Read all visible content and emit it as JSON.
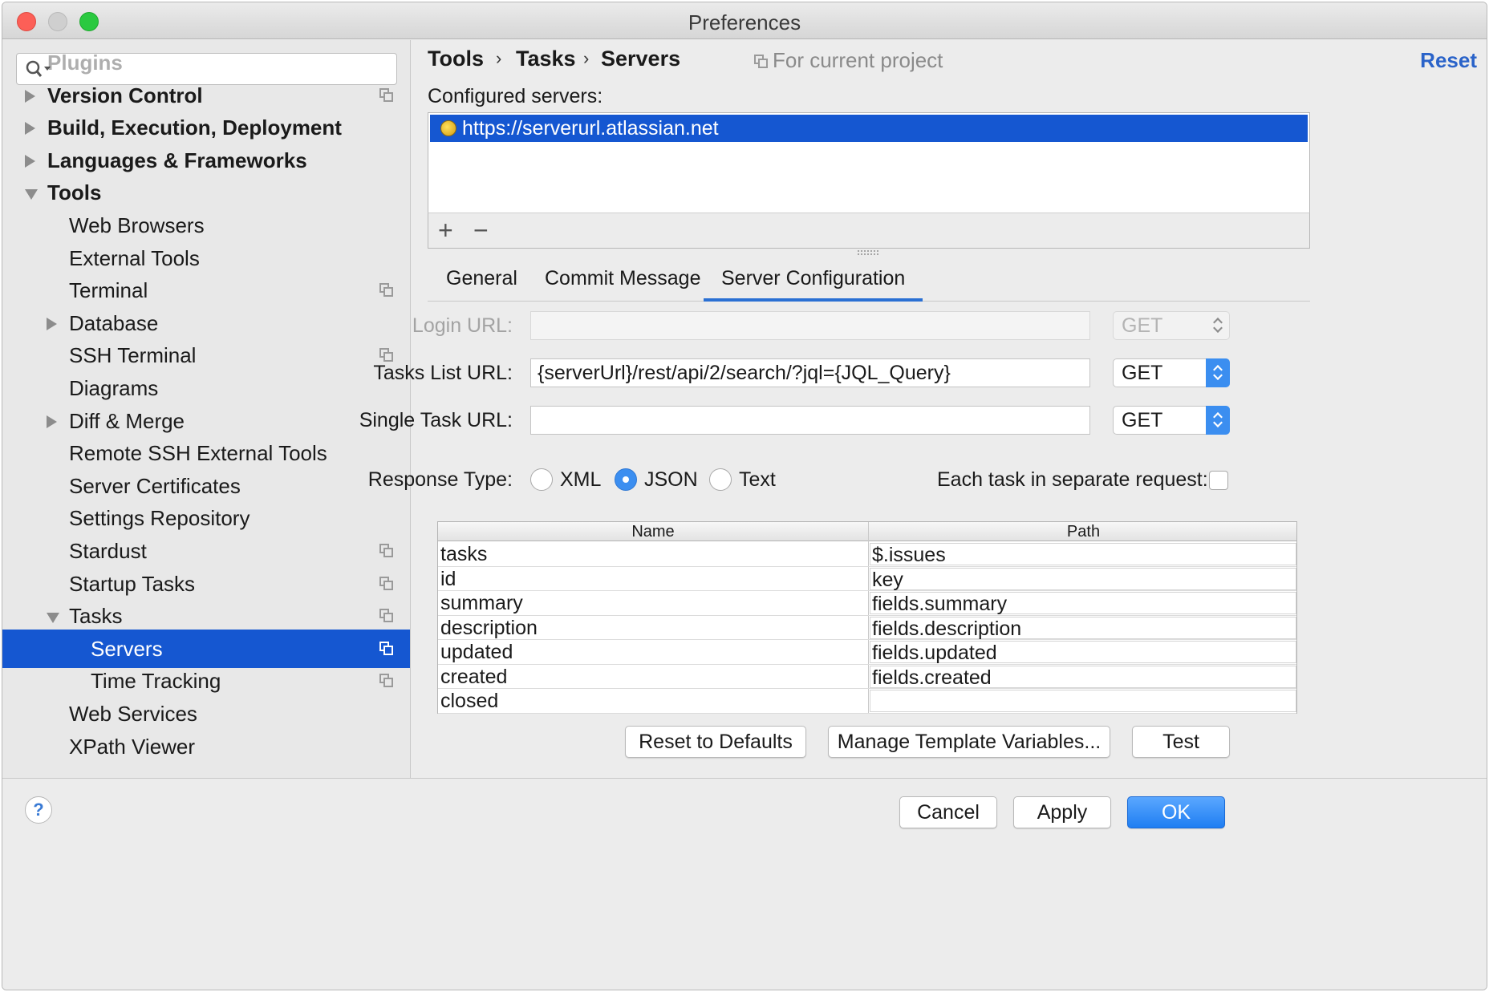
{
  "window": {
    "title": "Preferences"
  },
  "sidebar": {
    "search_placeholder": "",
    "items": [
      {
        "label": "Plugins",
        "level": 0,
        "arrow": "none",
        "bold": true,
        "project": false,
        "partial": true
      },
      {
        "label": "Version Control",
        "level": 0,
        "arrow": "right",
        "bold": true,
        "project": true
      },
      {
        "label": "Build, Execution, Deployment",
        "level": 0,
        "arrow": "right",
        "bold": true,
        "project": false
      },
      {
        "label": "Languages & Frameworks",
        "level": 0,
        "arrow": "right",
        "bold": true,
        "project": false
      },
      {
        "label": "Tools",
        "level": 0,
        "arrow": "down",
        "bold": true,
        "project": false
      },
      {
        "label": "Web Browsers",
        "level": 1,
        "arrow": "none",
        "project": false
      },
      {
        "label": "External Tools",
        "level": 1,
        "arrow": "none",
        "project": false
      },
      {
        "label": "Terminal",
        "level": 1,
        "arrow": "none",
        "project": true
      },
      {
        "label": "Database",
        "level": 1,
        "arrow": "right",
        "project": false
      },
      {
        "label": "SSH Terminal",
        "level": 1,
        "arrow": "none",
        "project": true
      },
      {
        "label": "Diagrams",
        "level": 1,
        "arrow": "none",
        "project": false
      },
      {
        "label": "Diff & Merge",
        "level": 1,
        "arrow": "right",
        "project": false
      },
      {
        "label": "Remote SSH External Tools",
        "level": 1,
        "arrow": "none",
        "project": false
      },
      {
        "label": "Server Certificates",
        "level": 1,
        "arrow": "none",
        "project": false
      },
      {
        "label": "Settings Repository",
        "level": 1,
        "arrow": "none",
        "project": false
      },
      {
        "label": "Stardust",
        "level": 1,
        "arrow": "none",
        "project": true
      },
      {
        "label": "Startup Tasks",
        "level": 1,
        "arrow": "none",
        "project": true
      },
      {
        "label": "Tasks",
        "level": 1,
        "arrow": "down",
        "project": true
      },
      {
        "label": "Servers",
        "level": 2,
        "arrow": "none",
        "project": true,
        "selected": true
      },
      {
        "label": "Time Tracking",
        "level": 2,
        "arrow": "none",
        "project": true
      },
      {
        "label": "Web Services",
        "level": 1,
        "arrow": "none",
        "project": false
      },
      {
        "label": "XPath Viewer",
        "level": 1,
        "arrow": "none",
        "project": false
      }
    ]
  },
  "breadcrumb": [
    "Tools",
    "Tasks",
    "Servers"
  ],
  "scope_label": "For current project",
  "reset_label": "Reset",
  "configured_servers_label": "Configured servers:",
  "servers": [
    "https://serverurl.atlassian.net"
  ],
  "list_toolbar": {
    "add": "+",
    "remove": "−"
  },
  "tabs": [
    {
      "label": "General",
      "active": false
    },
    {
      "label": "Commit Message",
      "active": false
    },
    {
      "label": "Server Configuration",
      "active": true
    }
  ],
  "form": {
    "login_url": {
      "label": "Login URL:",
      "value": "",
      "method": "GET",
      "enabled": false
    },
    "tasks_list_url": {
      "label": "Tasks List URL:",
      "value": "{serverUrl}/rest/api/2/search/?jql={JQL_Query}",
      "method": "GET",
      "enabled": true
    },
    "single_task_url": {
      "label": "Single Task URL:",
      "value": "",
      "method": "GET",
      "enabled": true
    },
    "response_type_label": "Response Type:",
    "response_types": [
      {
        "label": "XML",
        "selected": false
      },
      {
        "label": "JSON",
        "selected": true
      },
      {
        "label": "Text",
        "selected": false
      }
    ],
    "separate_request_label": "Each task in separate request:",
    "separate_request_checked": false
  },
  "selectors_table": {
    "headers": [
      "Name",
      "Path"
    ],
    "rows": [
      [
        "tasks",
        "$.issues"
      ],
      [
        "id",
        "key"
      ],
      [
        "summary",
        "fields.summary"
      ],
      [
        "description",
        "fields.description"
      ],
      [
        "updated",
        "fields.updated"
      ],
      [
        "created",
        "fields.created"
      ],
      [
        "closed",
        ""
      ]
    ]
  },
  "panel_buttons": [
    "Reset to Defaults",
    "Manage Template Variables...",
    "Test"
  ],
  "footer": {
    "help": "?",
    "cancel": "Cancel",
    "apply": "Apply",
    "ok": "OK"
  },
  "colors": {
    "selection": "#1557d1",
    "accent": "#3b8ef0",
    "link": "#2a63c9"
  }
}
